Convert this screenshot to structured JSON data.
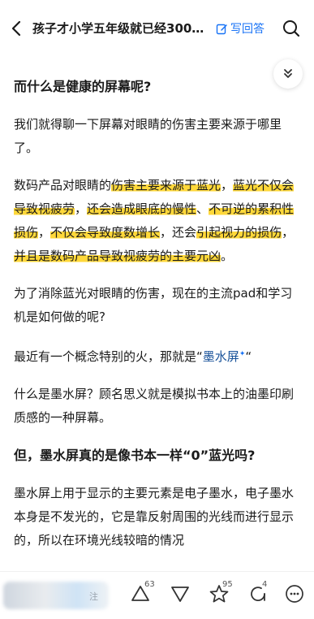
{
  "header": {
    "title": "孩子才小学五年级就已经300…",
    "write_answer_label": "写回答"
  },
  "article": {
    "heading1": "而什么是健康的屏幕呢?",
    "para1": "我们就得聊一下屏幕对眼睛的伤害主要来源于哪里了。",
    "para2": {
      "t1": "数码产品对眼睛的",
      "h1": "伤害主要来源于蓝光",
      "t2": "，",
      "h2": "蓝光不仅会导致视疲劳",
      "t3": "，",
      "h3": "还会造成眼底的慢性",
      "t4": "、",
      "h4": "不可逆的累积性损伤",
      "t5": "，",
      "h5": "不仅会导致度数增长",
      "t6": "，还会",
      "h6": "引起视力的损伤",
      "t7": "，",
      "h7": "并且是数码产品导致视疲劳的主要元凶",
      "t8": "。"
    },
    "para3": "为了消除蓝光对眼睛的伤害，现在的主流pad和学习机是如何做的呢?",
    "para4": {
      "prefix": "最近有一个概念特别的火，那就是",
      "open_quote": "“",
      "link": "墨水屏",
      "spark": "✦",
      "close_quote": "“"
    },
    "para5": "什么是墨水屏？顾名思义就是模拟书本上的油墨印刷质感的一种屏幕。",
    "heading2": "但，墨水屏真的是像书本一样“0”蓝光吗?",
    "para6": "墨水屏上用于显示的主要元素是电子墨水，电子墨水本身是不发光的，它是靠反射周围的光线而进行显示的，所以在环境光线较暗的情况"
  },
  "bottom": {
    "blurred_label": "注",
    "agree_count": "63",
    "star_count": "95",
    "comment_count": "4"
  },
  "colors": {
    "accent": "#1772f6",
    "highlight": "#ffd83a",
    "link": "#175199"
  }
}
